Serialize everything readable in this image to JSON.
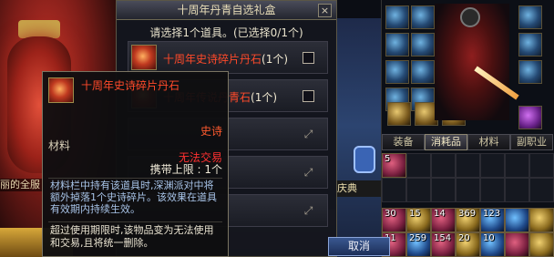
{
  "background": {
    "left_text": "丽的全服",
    "town_sign": "庆典"
  },
  "gift_box": {
    "title": "十周年丹青自选礼盒",
    "close_label": "×",
    "subtitle": "请选择1个道具。(已选择0/1个)",
    "items": [
      {
        "name": "十周年史诗碎片丹石",
        "count": "(1个)",
        "control": "checkbox"
      },
      {
        "name": "十周年传说丹青石",
        "count": "(1个)",
        "control": "checkbox"
      },
      {
        "name": "",
        "count": "",
        "control": "magnifier"
      },
      {
        "name": "",
        "count": "",
        "control": "magnifier"
      },
      {
        "name": "",
        "count": "",
        "control": "magnifier"
      }
    ],
    "cancel_label": "取消"
  },
  "tooltip": {
    "name": "十周年史诗碎片丹石",
    "rarity": "史诗",
    "type": "材料",
    "trade": "无法交易",
    "limit": "携带上限 : 1个",
    "description": "材料栏中持有该道具时,深渊派对中将额外掉落1个史诗碎片。该效果在道具有效期内持续生效。",
    "expire": "超过使用期限时,该物品变为无法使用和交易,且将统一删除。"
  },
  "equipment": {
    "tabs": [
      "装备",
      "消耗品",
      "材料",
      "副职业"
    ],
    "active_tab": "消耗品",
    "inventory_counts": [
      "5",
      "30",
      "15",
      "14",
      "369",
      "123",
      "",
      "11",
      "259",
      "154",
      "20",
      "10"
    ]
  },
  "colors": {
    "epic": "#ff4a2a",
    "untradeable": "#ff3030",
    "description": "#a8c4e8"
  }
}
